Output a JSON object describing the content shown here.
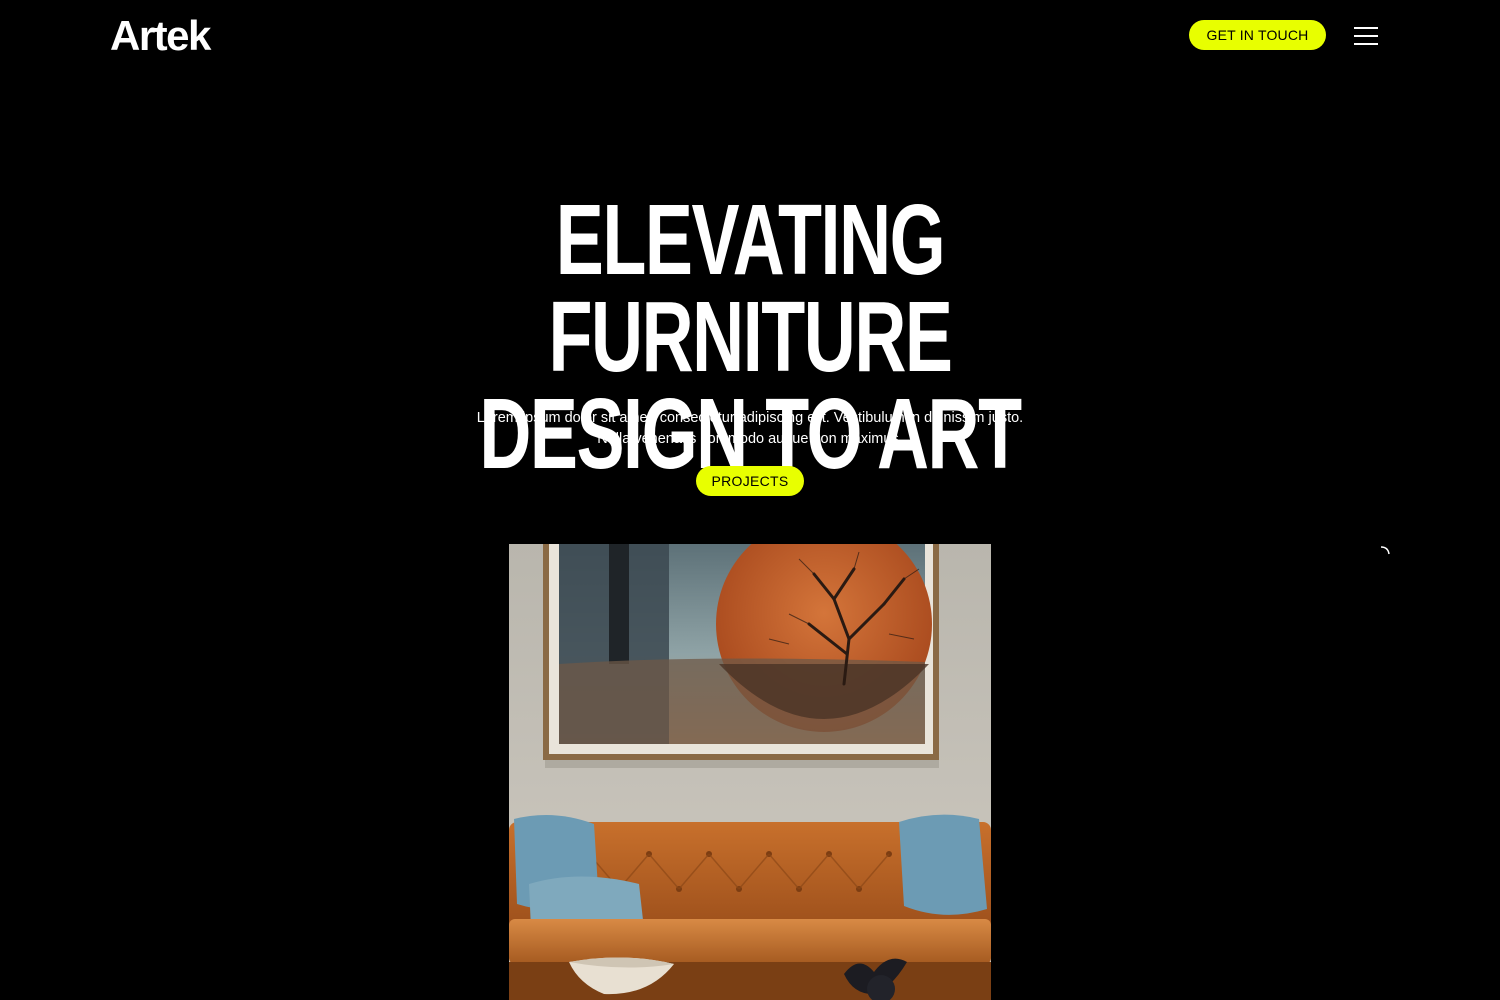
{
  "header": {
    "logo": "Artek",
    "cta_label": "GET IN TOUCH",
    "menu_icon": "hamburger-menu-icon"
  },
  "hero": {
    "title_line1": "ELEVATING FURNITURE",
    "title_line2": "DESIGN TO ART",
    "subtitle": "Lorem ipsum dolor sit amet, consectetur adipiscing elit. Vestibulum in dignissim justo. Nulla venenatis commodo augue non maximus.",
    "button_label": "PROJECTS",
    "image_alt": "Living room with orange tufted sofa, blue cushions and framed tree artwork"
  },
  "colors": {
    "background": "#000000",
    "accent": "#e8ff00",
    "text": "#ffffff"
  }
}
